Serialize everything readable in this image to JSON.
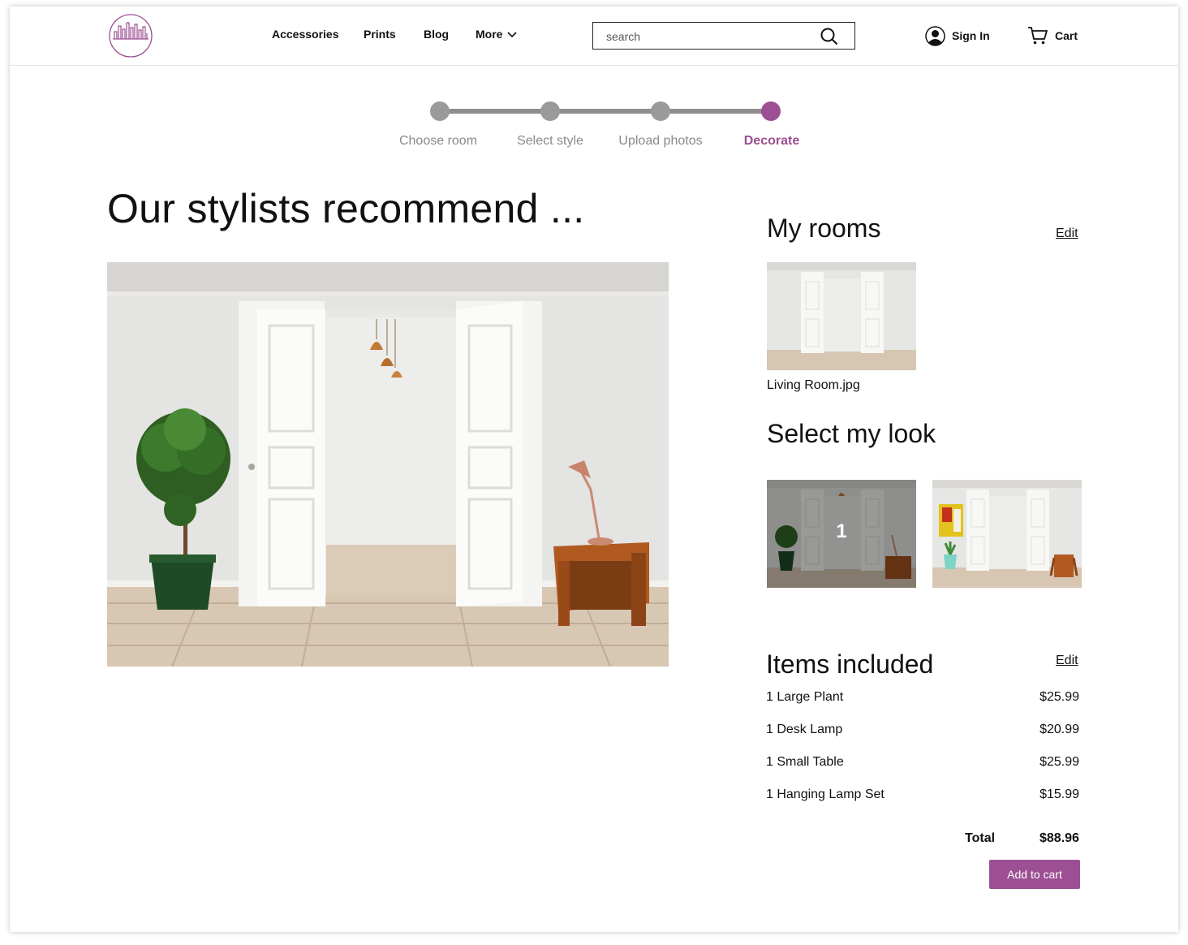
{
  "header": {
    "nav": [
      "Accessories",
      "Prints",
      "Blog",
      "More"
    ],
    "search_placeholder": "search",
    "sign_in": "Sign In",
    "cart": "Cart"
  },
  "stepper": {
    "steps": [
      "Choose room",
      "Select style",
      "Upload photos",
      "Decorate"
    ],
    "active_index": 3
  },
  "main": {
    "title": "Our stylists recommend ..."
  },
  "sidebar": {
    "my_rooms_title": "My rooms",
    "my_rooms_edit": "Edit",
    "room_name": "Living Room.jpg",
    "select_look_title": "Select my look",
    "selected_look_number": "1",
    "items_title": "Items included",
    "items_edit": "Edit",
    "items": [
      {
        "name": "1 Large Plant",
        "price": "$25.99"
      },
      {
        "name": "1 Desk Lamp",
        "price": "$20.99"
      },
      {
        "name": "1 Small Table",
        "price": "$25.99"
      },
      {
        "name": "1 Hanging Lamp Set",
        "price": "$15.99"
      }
    ],
    "total_label": "Total",
    "total_value": "$88.96",
    "add_to_cart": "Add to cart"
  },
  "colors": {
    "accent": "#9c4f92",
    "step_inactive": "#9a9a9a"
  },
  "icons": [
    "city-skyline-logo",
    "chevron-down-icon",
    "search-icon",
    "user-icon",
    "cart-icon"
  ]
}
